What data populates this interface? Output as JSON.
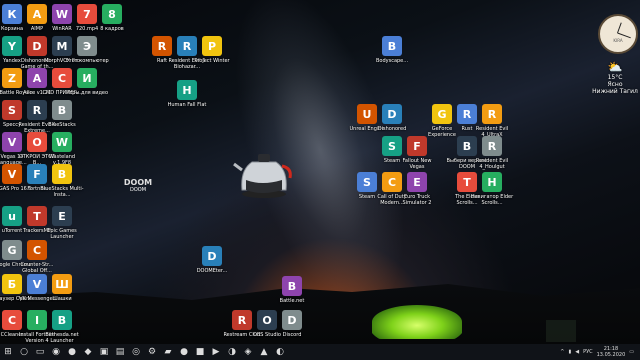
{
  "desktop_icons": [
    {
      "label": "Корзина",
      "x": "2",
      "y": "4"
    },
    {
      "label": "AIMP",
      "x": "27",
      "y": "4"
    },
    {
      "label": "WinRAR",
      "x": "52",
      "y": "4"
    },
    {
      "label": "720.mp4",
      "x": "77",
      "y": "4"
    },
    {
      "label": "8 кадров",
      "x": "102",
      "y": "4"
    },
    {
      "label": "Yandex",
      "x": "2",
      "y": "36"
    },
    {
      "label": "Dishonored - Game of th...",
      "x": "27",
      "y": "36"
    },
    {
      "label": "MorphVOX Pro",
      "x": "52",
      "y": "36"
    },
    {
      "label": "Этот компьютер",
      "x": "77",
      "y": "36"
    },
    {
      "label": "Raft",
      "x": "152",
      "y": "36"
    },
    {
      "label": "Resident Evil 6 Biohazar...",
      "x": "177",
      "y": "36"
    },
    {
      "label": "Project Winter",
      "x": "202",
      "y": "36"
    },
    {
      "label": "Bodyscape...",
      "x": "382",
      "y": "36"
    },
    {
      "label": "Z1 Battle Royale",
      "x": "2",
      "y": "68"
    },
    {
      "label": "Alice v1.21",
      "x": "27",
      "y": "68"
    },
    {
      "label": "CMD ПРИМЕР...",
      "x": "52",
      "y": "68"
    },
    {
      "label": "Игры для видео",
      "x": "77",
      "y": "68"
    },
    {
      "label": "Human Fall Flat",
      "x": "177",
      "y": "80"
    },
    {
      "label": "Speccy",
      "x": "2",
      "y": "100"
    },
    {
      "label": "Resident Evil 4 Extreme...",
      "x": "27",
      "y": "100"
    },
    {
      "label": "BlueStacks",
      "x": "52",
      "y": "100"
    },
    {
      "label": "Unreal Engine",
      "x": "357",
      "y": "104"
    },
    {
      "label": "Dishonored",
      "x": "382",
      "y": "104"
    },
    {
      "label": "GeForce Experience",
      "x": "432",
      "y": "104"
    },
    {
      "label": "Rust",
      "x": "457",
      "y": "104"
    },
    {
      "label": "Resident Evil 4_UltraX",
      "x": "482",
      "y": "104"
    },
    {
      "label": "Vegas 14 Language...",
      "x": "2",
      "y": "132"
    },
    {
      "label": "ОТКРОЙ ЭТОТ В...",
      "x": "27",
      "y": "132"
    },
    {
      "label": "Wasteland v.1.9F8",
      "x": "52",
      "y": "132"
    },
    {
      "label": "Steam",
      "x": "382",
      "y": "136"
    },
    {
      "label": "Fallout New Vegas",
      "x": "407",
      "y": "136"
    },
    {
      "label": "Выбери версию DOOM",
      "x": "457",
      "y": "136"
    },
    {
      "label": "Resident Evil 4_Houlgut",
      "x": "482",
      "y": "136"
    },
    {
      "label": "VEGAS Pro 16.0",
      "x": "2",
      "y": "164"
    },
    {
      "label": "Fortnite",
      "x": "27",
      "y": "164"
    },
    {
      "label": "BlueStacks Multi-Insta...",
      "x": "52",
      "y": "164"
    },
    {
      "label": "Steam",
      "x": "357",
      "y": "172"
    },
    {
      "label": "Call of Duty Modern...",
      "x": "382",
      "y": "172"
    },
    {
      "label": "Euro Truck Simulator 2",
      "x": "407",
      "y": "172"
    },
    {
      "label": "The Elder Scrolls...",
      "x": "457",
      "y": "172"
    },
    {
      "label": "Навигатор Elder Scrolls...",
      "x": "482",
      "y": "172"
    },
    {
      "label": "uTorrent",
      "x": "2",
      "y": "206"
    },
    {
      "label": "TrackersMP",
      "x": "27",
      "y": "206"
    },
    {
      "label": "Epic Games Launcher",
      "x": "52",
      "y": "206"
    },
    {
      "label": "Google Chrome",
      "x": "2",
      "y": "240"
    },
    {
      "label": "Counter-Str... Global Off...",
      "x": "27",
      "y": "240"
    },
    {
      "label": "DOOMEter...",
      "x": "202",
      "y": "246"
    },
    {
      "label": "Браузер Opera",
      "x": "2",
      "y": "274"
    },
    {
      "label": "VK Messenger",
      "x": "27",
      "y": "274"
    },
    {
      "label": "Шашки",
      "x": "52",
      "y": "274"
    },
    {
      "label": "Battle.net",
      "x": "282",
      "y": "276"
    },
    {
      "label": "CCleaner",
      "x": "2",
      "y": "310"
    },
    {
      "label": "Install Fortnite Version 4",
      "x": "27",
      "y": "310"
    },
    {
      "label": "Bethesda.net Launcher",
      "x": "52",
      "y": "310"
    },
    {
      "label": "Restream Chat",
      "x": "232",
      "y": "310"
    },
    {
      "label": "OBS Studio",
      "x": "257",
      "y": "310"
    },
    {
      "label": "Discord",
      "x": "282",
      "y": "310"
    }
  ],
  "doom_label": "DOOM",
  "clock": {
    "label": "KIRA"
  },
  "weather": {
    "temp": "15°C",
    "sub": "Ясно",
    "city": "Нижний Тагил"
  },
  "taskbar": {
    "lang": "РУС",
    "time": "21:18",
    "date": "13.05.2020",
    "pinned": [
      "⊞",
      "○",
      "▭",
      "◉",
      "●",
      "◆",
      "▣",
      "▤",
      "◎",
      "⚙",
      "▰",
      "●",
      "■",
      "▶",
      "◑",
      "◈",
      "▲",
      "◐"
    ]
  },
  "colors": {
    "icon_colors": [
      "#4b7fd6",
      "#f39c12",
      "#8e44ad",
      "#e74c3c",
      "#27ae60",
      "#16a085",
      "#c0392b",
      "#2c3e50",
      "#7f8c8d",
      "#d35400",
      "#2980b9",
      "#f1c40f"
    ]
  }
}
